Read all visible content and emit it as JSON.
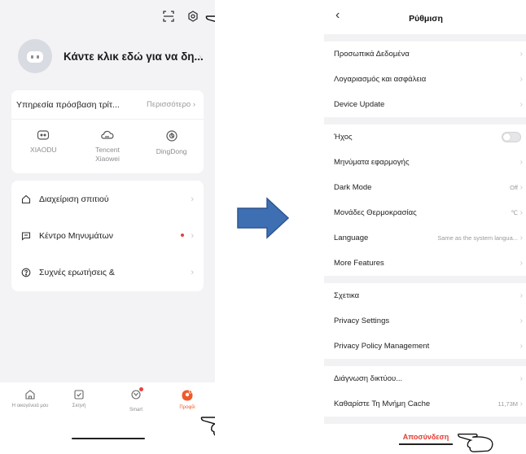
{
  "left": {
    "profile_name": "Κάντε κλικ εδώ για να δη...",
    "services": {
      "title": "Υπηρεσία πρόσβαση τρίτ...",
      "more": "Περισσότερο",
      "items": [
        {
          "label": "XIAODU",
          "icon": "xiaodu-icon"
        },
        {
          "label": "Tencent Xiaowei",
          "icon": "tencent-icon"
        },
        {
          "label": "DingDong",
          "icon": "dingdong-icon"
        }
      ]
    },
    "menu": [
      {
        "label": "Διαχείριση σπιτιού",
        "icon": "home-icon"
      },
      {
        "label": "Κέντρο Μηνυμάτων",
        "icon": "message-icon",
        "badge": true
      },
      {
        "label": "Συχνές ερωτήσεις &",
        "icon": "help-icon"
      }
    ],
    "nav": [
      {
        "label": "Η οικογένειά μου",
        "icon": "home-icon"
      },
      {
        "label": "Σκηνή",
        "icon": "scene-icon"
      },
      {
        "label": "Smart",
        "icon": "smart-icon"
      },
      {
        "label": "Προφίλ",
        "icon": "profile-icon",
        "active": true
      }
    ],
    "accent_color": "#f0592a"
  },
  "right": {
    "title": "Ρύθμιση",
    "groups": [
      [
        {
          "label": "Προσωπικά Δεδομένα"
        },
        {
          "label": "Λογαριασμός και ασφάλεια"
        },
        {
          "label": "Device Update"
        }
      ],
      [
        {
          "label": "Ήχος",
          "toggle": "off"
        },
        {
          "label": "Μηνύματα εφαρμογής"
        },
        {
          "label": "Dark Mode",
          "value": "Off"
        },
        {
          "label": "Μονάδες Θερμοκρασίας",
          "value": "℃"
        },
        {
          "label": "Language",
          "value": "Same as the system langua..."
        },
        {
          "label": "More Features"
        }
      ],
      [
        {
          "label": "Σχετικα"
        },
        {
          "label": "Privacy Settings"
        },
        {
          "label": "Privacy Policy Management"
        }
      ],
      [
        {
          "label": "Διάγνωση δικτύου..."
        },
        {
          "label": "Καθαρίστε Τη Μνήμη Cache",
          "value": "11,73M"
        }
      ]
    ],
    "logout": "Αποσύνδεση",
    "logout_color": "#e23a2f"
  }
}
